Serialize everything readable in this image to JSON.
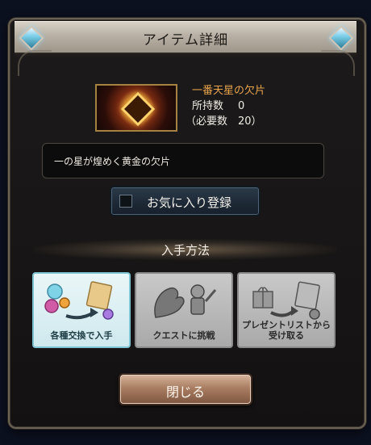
{
  "dialog": {
    "title": "アイテム詳細"
  },
  "item": {
    "name": "一番天星の欠片",
    "owned_label": "所持数",
    "owned_value": "0",
    "required_text": "（必要数　20）",
    "description": "一の星が煌めく黄金の欠片"
  },
  "favorite": {
    "label": "お気に入り登録",
    "checked": false
  },
  "obtain": {
    "title": "入手方法",
    "methods": [
      {
        "label": "各種交換で入手",
        "active": true
      },
      {
        "label": "クエストに挑戦",
        "active": false
      },
      {
        "label_line1": "プレゼントリストから",
        "label_line2": "受け取る",
        "active": false
      }
    ]
  },
  "close_label": "閉じる",
  "colors": {
    "item_name": "#e9a44c",
    "active_card_border": "#7fc4d2"
  }
}
